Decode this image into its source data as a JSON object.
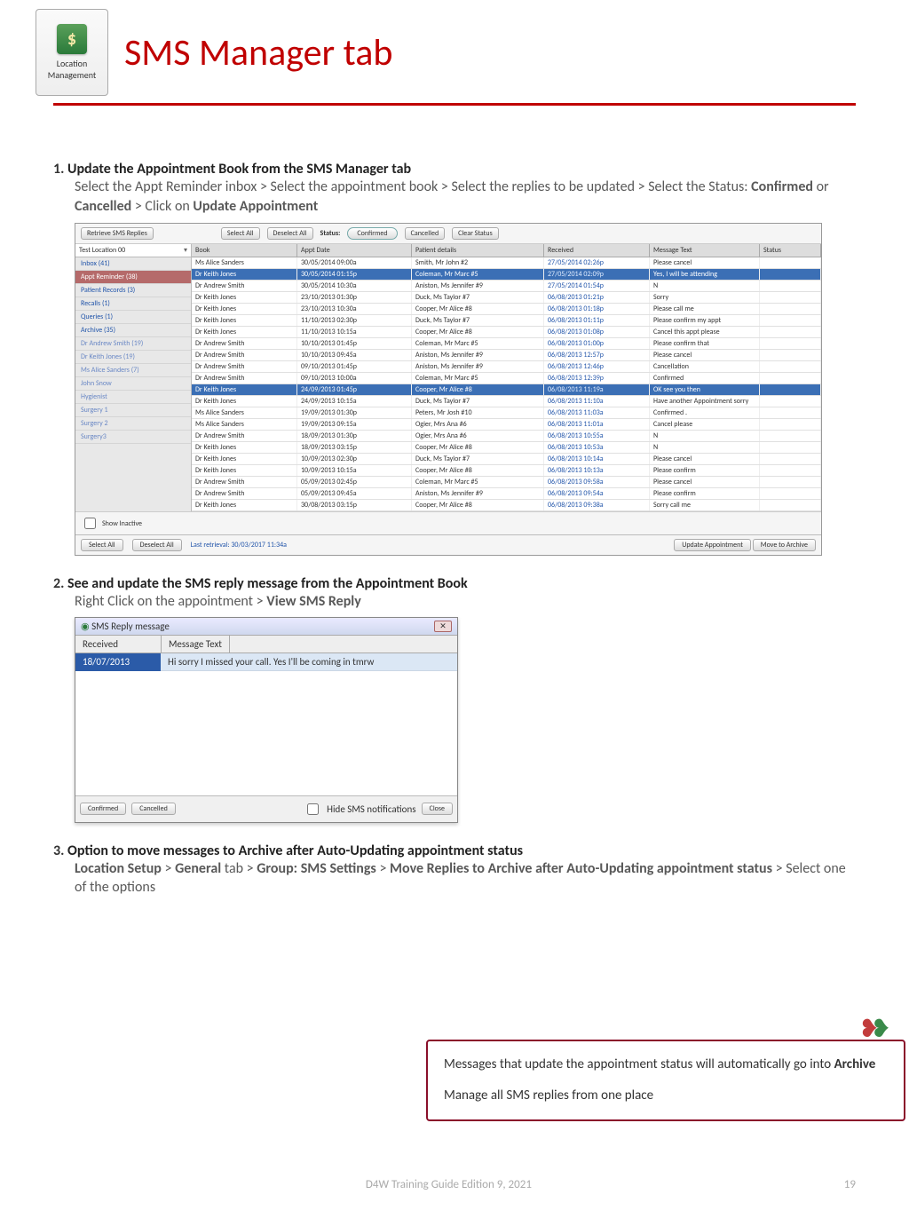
{
  "header": {
    "logo_line1": "Location",
    "logo_line2": "Management",
    "title": "SMS Manager tab"
  },
  "section1": {
    "num": "1.",
    "head": "Update the Appointment Book from the SMS Manager tab",
    "body1": "Select the Appt Reminder inbox > Select the appointment book > Select the replies to be updated > Select the Status: ",
    "confirmed": "Confirmed",
    "or": " or ",
    "cancelled": "Cancelled",
    "body2": " > Click on ",
    "update": "Update Appointment"
  },
  "ss": {
    "retrieve": "Retrieve SMS Replies",
    "select_all": "Select All",
    "deselect_all": "Deselect All",
    "status_lbl": "Status:",
    "confirmed": "Confirmed",
    "cancelled": "Cancelled",
    "clear": "Clear Status",
    "location": "Test Location 00",
    "side": [
      {
        "label": "Inbox  (41)"
      },
      {
        "label": "Appt Reminder  (38)",
        "sel": true
      },
      {
        "label": "Patient Records  (3)"
      },
      {
        "label": "Recalls  (1)"
      },
      {
        "label": "Queries  (1)"
      },
      {
        "label": "Archive  (35)"
      },
      {
        "label": "Dr Andrew Smith (19)",
        "dim": true
      },
      {
        "label": "Dr Keith Jones (19)",
        "dim": true
      },
      {
        "label": "Ms Alice Sanders (7)",
        "dim": true
      },
      {
        "label": "John Snow",
        "dim": true
      },
      {
        "label": "Hygienist",
        "dim": true
      },
      {
        "label": "Surgery 1",
        "dim": true
      },
      {
        "label": "Surgery 2",
        "dim": true
      },
      {
        "label": "Surgery3",
        "dim": true
      }
    ],
    "cols": {
      "book": "Book",
      "appt": "Appt Date",
      "pat": "Patient details",
      "recv": "Received",
      "msg": "Message Text",
      "stat": "Status"
    },
    "rows": [
      {
        "book": "Ms Alice Sanders",
        "appt": "30/05/2014 09:00a",
        "pat": "Smith, Mr John #2",
        "recv": "27/05/2014 02:26p",
        "msg": "Please cancel"
      },
      {
        "book": "Dr Keith Jones",
        "appt": "30/05/2014 01:15p",
        "pat": "Coleman, Mr Marc #5",
        "recv": "27/05/2014 02:09p",
        "msg": "Yes, I will be attending",
        "hi": true,
        "sel": true
      },
      {
        "book": "Dr Andrew Smith",
        "appt": "30/05/2014 10:30a",
        "pat": "Aniston, Ms Jennifer #9",
        "recv": "27/05/2014 01:54p",
        "msg": "N"
      },
      {
        "book": "Dr Keith Jones",
        "appt": "23/10/2013 01:30p",
        "pat": "Duck, Ms Taylor #7",
        "recv": "06/08/2013 01:21p",
        "msg": "Sorry"
      },
      {
        "book": "Dr Keith Jones",
        "appt": "23/10/2013 10:30a",
        "pat": "Cooper, Mr Alice #8",
        "recv": "06/08/2013 01:18p",
        "msg": "Please call me"
      },
      {
        "book": "Dr Keith Jones",
        "appt": "11/10/2013 02:30p",
        "pat": "Duck, Ms Taylor #7",
        "recv": "06/08/2013 01:11p",
        "msg": "Please confirm my appt"
      },
      {
        "book": "Dr Keith Jones",
        "appt": "11/10/2013 10:15a",
        "pat": "Cooper, Mr Alice #8",
        "recv": "06/08/2013 01:08p",
        "msg": "Cancel this appt please"
      },
      {
        "book": "Dr Andrew Smith",
        "appt": "10/10/2013 01:45p",
        "pat": "Coleman, Mr Marc #5",
        "recv": "06/08/2013 01:00p",
        "msg": "Please confirm that"
      },
      {
        "book": "Dr Andrew Smith",
        "appt": "10/10/2013 09:45a",
        "pat": "Aniston, Ms Jennifer #9",
        "recv": "06/08/2013 12:57p",
        "msg": "Please cancel"
      },
      {
        "book": "Dr Andrew Smith",
        "appt": "09/10/2013 01:45p",
        "pat": "Aniston, Ms Jennifer #9",
        "recv": "06/08/2013 12:46p",
        "msg": "Cancellation"
      },
      {
        "book": "Dr Andrew Smith",
        "appt": "09/10/2013 10:00a",
        "pat": "Coleman, Mr Marc #5",
        "recv": "06/08/2013 12:39p",
        "msg": "Confirmed"
      },
      {
        "book": "Dr Keith Jones",
        "appt": "24/09/2013 01:45p",
        "pat": "Cooper, Mr Alice #8",
        "recv": "06/08/2013 11:19a",
        "msg": "OK see you then",
        "hi": true,
        "sel": true
      },
      {
        "book": "Dr Keith Jones",
        "appt": "24/09/2013 10:15a",
        "pat": "Duck, Ms Taylor #7",
        "recv": "06/08/2013 11:10a",
        "msg": "Have  another Appointment sorry"
      },
      {
        "book": "Ms Alice Sanders",
        "appt": "19/09/2013 01:30p",
        "pat": "Peters, Mr Josh #10",
        "recv": "06/08/2013 11:03a",
        "msg": "Confirmed ."
      },
      {
        "book": "Ms Alice Sanders",
        "appt": "19/09/2013 09:15a",
        "pat": "Ogier, Mrs Ana #6",
        "recv": "06/08/2013 11:01a",
        "msg": "Cancel please"
      },
      {
        "book": "Dr Andrew Smith",
        "appt": "18/09/2013 01:30p",
        "pat": "Ogier, Mrs Ana #6",
        "recv": "06/08/2013 10:55a",
        "msg": "N"
      },
      {
        "book": "Dr Keith Jones",
        "appt": "18/09/2013 03:15p",
        "pat": "Cooper, Mr Alice #8",
        "recv": "06/08/2013 10:53a",
        "msg": "N"
      },
      {
        "book": "Dr Keith Jones",
        "appt": "10/09/2013 02:30p",
        "pat": "Duck, Ms Taylor #7",
        "recv": "06/08/2013 10:14a",
        "msg": "Please cancel"
      },
      {
        "book": "Dr Keith Jones",
        "appt": "10/09/2013 10:15a",
        "pat": "Cooper, Mr Alice #8",
        "recv": "06/08/2013 10:13a",
        "msg": "Please confirm"
      },
      {
        "book": "Dr Andrew Smith",
        "appt": "05/09/2013 02:45p",
        "pat": "Coleman, Mr Marc #5",
        "recv": "06/08/2013 09:58a",
        "msg": "Please cancel"
      },
      {
        "book": "Dr Andrew Smith",
        "appt": "05/09/2013 09:45a",
        "pat": "Aniston, Ms Jennifer #9",
        "recv": "06/08/2013 09:54a",
        "msg": "Please confirm"
      },
      {
        "book": "Dr Keith Jones",
        "appt": "30/08/2013 03:15p",
        "pat": "Cooper, Mr Alice #8",
        "recv": "06/08/2013 09:38a",
        "msg": "Sorry call me"
      }
    ],
    "show_inactive": "Show Inactive",
    "last_retrieval": "Last retrieval: 30/03/2017 11:34a",
    "update_appt": "Update Appointment",
    "move_archive": "Move to Archive"
  },
  "section2": {
    "num": "2.",
    "head": "See and update the SMS reply message from the Appointment Book",
    "body": "Right Click on the appointment > ",
    "view": "View SMS Reply"
  },
  "reply": {
    "title": "SMS Reply message",
    "col_recv": "Received",
    "col_msg": "Message Text",
    "row_date": "18/07/2013",
    "row_msg": "Hi sorry I missed your call. Yes I'll be coming in tmrw",
    "confirmed": "Confirmed",
    "cancelled": "Cancelled",
    "hide": "Hide SMS notifications",
    "close": "Close"
  },
  "section3": {
    "num": "3.",
    "head": "Option to move messages to Archive after Auto-Updating appointment status",
    "p1": "Location Setup",
    "gt1": " > ",
    "p2": "General",
    "t": " tab > ",
    "p3": "Group: SMS Settings",
    "gt2": " > ",
    "p4": "Move Replies to Archive after Auto-Updating appointment status",
    "end": " > Select one of the options"
  },
  "callout": {
    "line1a": "Messages that update the appointment status will automatically go into ",
    "line1b": "Archive",
    "line2": "Manage all SMS replies from one place"
  },
  "footer": {
    "center": "D4W Training Guide Edition 9, 2021",
    "page": "19"
  }
}
